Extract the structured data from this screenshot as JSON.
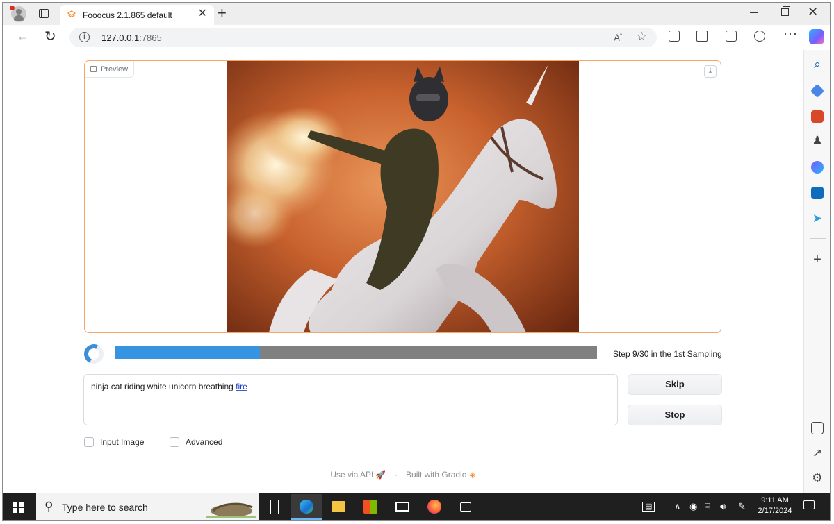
{
  "browser": {
    "tab_title": "Fooocus 2.1.865 default",
    "url_host": "127.0.0.1",
    "url_port": ":7865"
  },
  "app": {
    "preview_label": "Preview",
    "progress": {
      "fraction": 0.3,
      "text": "Step 9/30 in the 1st Sampling"
    },
    "prompt": {
      "text": "ninja cat riding white unicorn breathing ",
      "last_word": "fire"
    },
    "skip_label": "Skip",
    "stop_label": "Stop",
    "input_image_label": "Input Image",
    "advanced_label": "Advanced",
    "footer": {
      "api_text": "Use via API",
      "separator": "·",
      "gradio_text": "Built with Gradio"
    },
    "accent_color": "#f5a66a",
    "progress_color": "#3694e0"
  },
  "taskbar": {
    "search_placeholder": "Type here to search",
    "time": "9:11 AM",
    "date": "2/17/2024"
  }
}
